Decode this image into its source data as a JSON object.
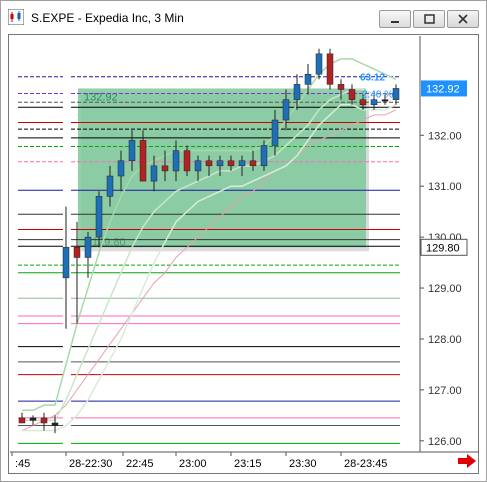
{
  "window": {
    "title": "S.EXPE - Expedia Inc, 3 Min",
    "controls": {
      "minimize": "minimize-icon",
      "restore": "restore-icon",
      "close": "close-icon"
    }
  },
  "chart_data": {
    "type": "candlestick",
    "symbol": "S.EXPE",
    "interval": "3 Min",
    "y_ticks": [
      126.0,
      127.0,
      128.0,
      129.0,
      130.0,
      131.0,
      132.0
    ],
    "y_tick_labels": [
      "126.00",
      "127.00",
      "128.00",
      "129.00",
      "130.00",
      "131.00",
      "132.00"
    ],
    "ylim": [
      125.78,
      133.95
    ],
    "x_ticks": [
      ":45",
      "28-22:30",
      "22:45",
      "23:00",
      "23:15",
      "23:30",
      "28-23:45"
    ],
    "current_price": {
      "value": 132.92,
      "label": "132.92",
      "color": "#1e90ff"
    },
    "marked_price": {
      "value": 129.8,
      "label": "129.80",
      "color": "#000000"
    },
    "zone": {
      "top": 132.92,
      "bottom": 129.8,
      "label_top": "132.92",
      "label_bottom": "129.80",
      "fill": "#7ec99a"
    },
    "overlay_labels": [
      "63.12",
      "2.40 %"
    ],
    "candles": [
      {
        "o": 126.45,
        "h": 126.55,
        "l": 126.35,
        "c": 126.35
      },
      {
        "o": 126.4,
        "h": 126.5,
        "l": 126.3,
        "c": 126.45
      },
      {
        "o": 126.45,
        "h": 126.55,
        "l": 126.2,
        "c": 126.35
      },
      {
        "o": 126.35,
        "h": 126.5,
        "l": 126.15,
        "c": 126.3
      },
      {
        "o": 129.2,
        "h": 130.6,
        "l": 128.2,
        "c": 129.8
      },
      {
        "o": 129.8,
        "h": 130.3,
        "l": 128.3,
        "c": 129.6
      },
      {
        "o": 129.6,
        "h": 130.1,
        "l": 129.2,
        "c": 130.0
      },
      {
        "o": 130.0,
        "h": 130.9,
        "l": 129.8,
        "c": 130.8
      },
      {
        "o": 130.8,
        "h": 131.4,
        "l": 130.6,
        "c": 131.2
      },
      {
        "o": 131.2,
        "h": 131.7,
        "l": 130.9,
        "c": 131.5
      },
      {
        "o": 131.5,
        "h": 132.1,
        "l": 131.3,
        "c": 131.9
      },
      {
        "o": 131.9,
        "h": 132.1,
        "l": 131.2,
        "c": 131.1
      },
      {
        "o": 131.1,
        "h": 131.6,
        "l": 130.9,
        "c": 131.4
      },
      {
        "o": 131.4,
        "h": 131.7,
        "l": 131.1,
        "c": 131.3
      },
      {
        "o": 131.3,
        "h": 131.9,
        "l": 131.1,
        "c": 131.7
      },
      {
        "o": 131.7,
        "h": 131.8,
        "l": 131.2,
        "c": 131.3
      },
      {
        "o": 131.3,
        "h": 131.6,
        "l": 131.1,
        "c": 131.5
      },
      {
        "o": 131.5,
        "h": 131.6,
        "l": 131.2,
        "c": 131.4
      },
      {
        "o": 131.4,
        "h": 131.6,
        "l": 131.2,
        "c": 131.5
      },
      {
        "o": 131.5,
        "h": 131.6,
        "l": 131.3,
        "c": 131.4
      },
      {
        "o": 131.4,
        "h": 131.6,
        "l": 131.2,
        "c": 131.5
      },
      {
        "o": 131.5,
        "h": 131.7,
        "l": 131.3,
        "c": 131.4
      },
      {
        "o": 131.4,
        "h": 131.9,
        "l": 131.3,
        "c": 131.8
      },
      {
        "o": 131.8,
        "h": 132.5,
        "l": 131.6,
        "c": 132.3
      },
      {
        "o": 132.3,
        "h": 132.9,
        "l": 132.1,
        "c": 132.7
      },
      {
        "o": 132.7,
        "h": 133.2,
        "l": 132.5,
        "c": 133.0
      },
      {
        "o": 133.0,
        "h": 133.4,
        "l": 132.8,
        "c": 133.2
      },
      {
        "o": 133.2,
        "h": 133.7,
        "l": 133.1,
        "c": 133.6
      },
      {
        "o": 133.6,
        "h": 133.7,
        "l": 132.9,
        "c": 133.0
      },
      {
        "o": 133.0,
        "h": 133.1,
        "l": 132.7,
        "c": 132.9
      },
      {
        "o": 132.9,
        "h": 133.0,
        "l": 132.6,
        "c": 132.7
      },
      {
        "o": 132.7,
        "h": 132.8,
        "l": 132.5,
        "c": 132.6
      },
      {
        "o": 132.6,
        "h": 132.8,
        "l": 132.5,
        "c": 132.7
      },
      {
        "o": 132.7,
        "h": 132.8,
        "l": 132.6,
        "c": 132.7
      },
      {
        "o": 132.7,
        "h": 133.0,
        "l": 132.6,
        "c": 132.92
      }
    ],
    "bands": {
      "upper": [
        126.6,
        126.6,
        126.7,
        126.7,
        127.5,
        128.3,
        129.0,
        129.7,
        130.3,
        130.8,
        131.2,
        131.4,
        131.5,
        131.6,
        131.7,
        131.7,
        131.7,
        131.7,
        131.7,
        131.7,
        131.7,
        131.7,
        131.8,
        132.0,
        132.3,
        132.6,
        132.9,
        133.2,
        133.4,
        133.5,
        133.5,
        133.4,
        133.3,
        133.2,
        133.1
      ],
      "middle": [
        126.4,
        126.4,
        126.4,
        126.4,
        126.8,
        127.3,
        127.8,
        128.3,
        128.8,
        129.3,
        129.8,
        130.2,
        130.5,
        130.7,
        130.9,
        131.0,
        131.1,
        131.2,
        131.3,
        131.3,
        131.4,
        131.4,
        131.5,
        131.6,
        131.8,
        132.0,
        132.2,
        132.5,
        132.7,
        132.8,
        132.9,
        132.9,
        132.8,
        132.8,
        132.8
      ],
      "lower": [
        126.2,
        126.2,
        126.2,
        126.2,
        126.3,
        126.5,
        126.8,
        127.2,
        127.6,
        128.0,
        128.5,
        129.0,
        129.5,
        129.9,
        130.3,
        130.5,
        130.7,
        130.8,
        130.9,
        131.0,
        131.0,
        131.1,
        131.2,
        131.3,
        131.4,
        131.6,
        131.9,
        132.2,
        132.4,
        132.6,
        132.6,
        132.5,
        132.5,
        132.5,
        132.6
      ],
      "slow_ma": [
        126.2,
        126.3,
        126.4,
        126.5,
        126.7,
        127.0,
        127.3,
        127.6,
        127.9,
        128.2,
        128.5,
        128.8,
        129.1,
        129.3,
        129.6,
        129.8,
        130.0,
        130.2,
        130.4,
        130.6,
        130.8,
        130.9,
        131.1,
        131.3,
        131.4,
        131.6,
        131.8,
        131.9,
        132.0,
        132.1,
        132.2,
        132.3,
        132.4,
        132.4,
        132.5
      ]
    },
    "level_lines": [
      {
        "price": 133.15,
        "color": "#1a1aa0",
        "style": "dashed"
      },
      {
        "price": 132.82,
        "color": "#8a2be2",
        "style": "dashed"
      },
      {
        "price": 132.65,
        "color": "#555555",
        "style": "dashed"
      },
      {
        "price": 132.55,
        "color": "#000000",
        "style": "solid"
      },
      {
        "price": 132.25,
        "color": "#cc0000",
        "style": "solid"
      },
      {
        "price": 132.12,
        "color": "#000000",
        "style": "dashed"
      },
      {
        "price": 131.95,
        "color": "#000000",
        "style": "solid"
      },
      {
        "price": 131.78,
        "color": "#00aa00",
        "style": "dashed"
      },
      {
        "price": 131.48,
        "color": "#ff69b4",
        "style": "dashed"
      },
      {
        "price": 130.92,
        "color": "#1a1aa0",
        "style": "solid"
      },
      {
        "price": 130.45,
        "color": "#333333",
        "style": "solid"
      },
      {
        "price": 130.15,
        "color": "#cc0000",
        "style": "solid"
      },
      {
        "price": 129.95,
        "color": "#333333",
        "style": "solid"
      },
      {
        "price": 129.82,
        "color": "#000000",
        "style": "solid"
      },
      {
        "price": 129.45,
        "color": "#00aa00",
        "style": "dashed"
      },
      {
        "price": 129.3,
        "color": "#00aa00",
        "style": "solid"
      },
      {
        "price": 128.8,
        "color": "#8fbc8f",
        "style": "solid"
      },
      {
        "price": 128.45,
        "color": "#ff69b4",
        "style": "solid"
      },
      {
        "price": 128.3,
        "color": "#ff69b4",
        "style": "solid"
      },
      {
        "price": 127.85,
        "color": "#000000",
        "style": "solid"
      },
      {
        "price": 127.55,
        "color": "#555555",
        "style": "solid"
      },
      {
        "price": 127.3,
        "color": "#cc0000",
        "style": "solid"
      },
      {
        "price": 126.78,
        "color": "#1a1aa0",
        "style": "solid"
      },
      {
        "price": 126.45,
        "color": "#ff69b4",
        "style": "solid"
      },
      {
        "price": 126.3,
        "color": "#555555",
        "style": "solid"
      },
      {
        "price": 125.95,
        "color": "#00aa00",
        "style": "solid"
      }
    ],
    "colors": {
      "up": "#1e6fb8",
      "down": "#b22222",
      "doji": "#222222",
      "upper_band": "#a8d8a8",
      "middle_band": "#c8e6c8",
      "lower_band": "#d8ecd8",
      "slow_ma": "#e8a0b0"
    }
  }
}
